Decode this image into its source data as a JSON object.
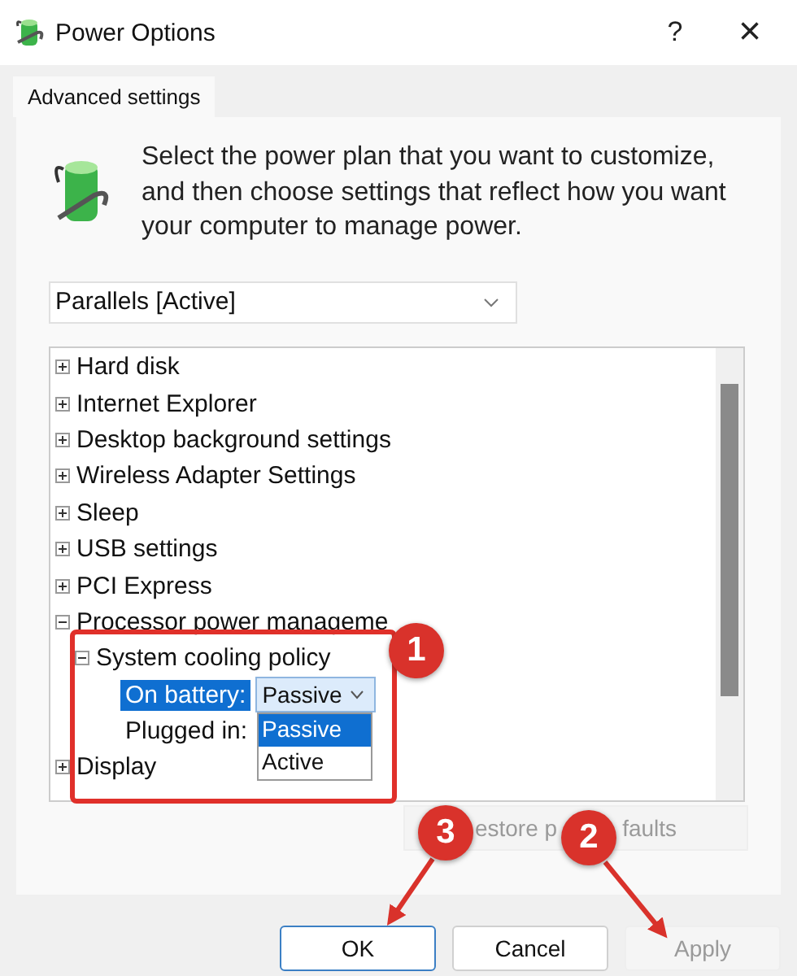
{
  "window": {
    "title": "Power Options",
    "help": "?",
    "close": "×"
  },
  "tabs": [
    {
      "label": "Advanced settings",
      "selected": true
    }
  ],
  "intro": "Select the power plan that you want to customize, and then choose settings that reflect how you want your computer to manage power.",
  "plan_dropdown": {
    "value": "Parallels [Active]"
  },
  "tree": [
    {
      "label": "Hard disk",
      "expanded": false
    },
    {
      "label": "Internet Explorer",
      "expanded": false
    },
    {
      "label": "Desktop background settings",
      "expanded": false
    },
    {
      "label": "Wireless Adapter Settings",
      "expanded": false
    },
    {
      "label": "Sleep",
      "expanded": false
    },
    {
      "label": "USB settings",
      "expanded": false
    },
    {
      "label": "PCI Express",
      "expanded": false
    },
    {
      "label": "Processor power manageme",
      "expanded": true,
      "children": [
        {
          "label": "System cooling policy",
          "expanded": true,
          "settings": [
            {
              "label": "On battery:",
              "selected": true,
              "value": "Passive",
              "open": true,
              "options": [
                {
                  "label": "Passive",
                  "selected": true
                },
                {
                  "label": "Active",
                  "selected": false
                }
              ]
            },
            {
              "label": "Plugged in:",
              "selected": false
            }
          ]
        }
      ]
    },
    {
      "label": "Display",
      "expanded": false
    }
  ],
  "restore_button": {
    "label_parts": [
      "estore p",
      "faults"
    ],
    "disabled": true
  },
  "buttons": [
    {
      "label": "OK",
      "kind": "default",
      "disabled": false
    },
    {
      "label": "Cancel",
      "kind": "normal",
      "disabled": false
    },
    {
      "label": "Apply",
      "kind": "normal",
      "disabled": true
    }
  ],
  "callouts": [
    {
      "number": "1"
    },
    {
      "number": "2"
    },
    {
      "number": "3"
    }
  ]
}
